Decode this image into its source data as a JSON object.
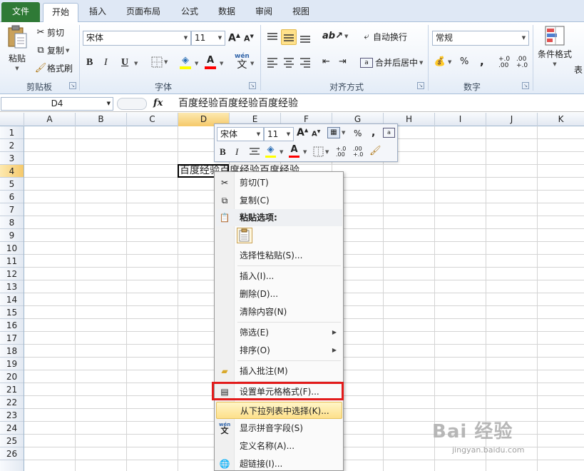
{
  "tabs": [
    "文件",
    "开始",
    "插入",
    "页面布局",
    "公式",
    "数据",
    "审阅",
    "视图"
  ],
  "clipboard": {
    "paste": "粘贴",
    "cut": "剪切",
    "copy": "复制",
    "format_painter": "格式刷",
    "group": "剪贴板"
  },
  "font": {
    "name": "宋体",
    "size": "11",
    "bold": "B",
    "italic": "I",
    "underline": "U",
    "group": "字体"
  },
  "alignment": {
    "wrap": "自动换行",
    "merge": "合并后居中",
    "group": "对齐方式"
  },
  "number": {
    "format": "常规",
    "percent": "%",
    "comma": ",",
    "inc_decimal": "+.0 .00",
    "dec_decimal": ".00 +.0",
    "group": "数字"
  },
  "styles": {
    "conditional": "条件格式",
    "table_partial": "表"
  },
  "formula_bar": {
    "cell_ref": "D4",
    "fx": "fx",
    "value": "百度经验百度经验百度经验"
  },
  "sheet": {
    "columns": [
      "A",
      "B",
      "C",
      "D",
      "E",
      "F",
      "G",
      "H",
      "I",
      "J",
      "K"
    ],
    "rows": [
      "1",
      "2",
      "3",
      "4",
      "5",
      "6",
      "7",
      "8",
      "9",
      "10",
      "11",
      "12",
      "13",
      "14",
      "15",
      "16",
      "17",
      "18",
      "19",
      "20",
      "21",
      "22",
      "23",
      "24",
      "25",
      "26"
    ],
    "d4_text": "百度经验百度经验百度经验"
  },
  "mini_toolbar": {
    "font": "宋体",
    "size": "11",
    "percent": "%",
    "comma": ",",
    "bold": "B",
    "italic": "I"
  },
  "context_menu": {
    "cut": "剪切(T)",
    "copy": "复制(C)",
    "paste_options": "粘贴选项:",
    "paste_special": "选择性粘贴(S)...",
    "insert": "插入(I)...",
    "delete": "删除(D)...",
    "clear": "清除内容(N)",
    "filter": "筛选(E)",
    "sort": "排序(O)",
    "insert_comment": "插入批注(M)",
    "format_cells": "设置单元格格式(F)...",
    "pick_list": "从下拉列表中选择(K)...",
    "phonetic": "显示拼音字段(S)",
    "define_name": "定义名称(A)...",
    "hyperlink": "超链接(I)..."
  },
  "watermark": {
    "main": "Bai 经验",
    "sub": "jingyan.baidu.com"
  },
  "colors": {
    "file_tab": "#2f7a36",
    "highlight_box": "#e21b1b",
    "hover_item": "#fde08a",
    "font_color": "#ff0000",
    "fill_color": "#ffff00"
  }
}
